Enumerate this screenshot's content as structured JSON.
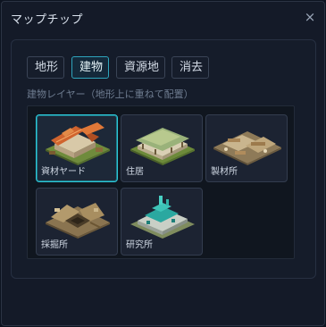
{
  "window": {
    "title": "マップチップ",
    "close_glyph": "×"
  },
  "tabs": [
    {
      "label": "地形",
      "active": false
    },
    {
      "label": "建物",
      "active": true
    },
    {
      "label": "資源地",
      "active": false
    },
    {
      "label": "消去",
      "active": false
    }
  ],
  "hint": "建物レイヤー（地形上に重ねて配置）",
  "tiles": [
    {
      "label": "資材ヤード",
      "icon": "materials-yard-icon",
      "selected": true
    },
    {
      "label": "住居",
      "icon": "house-icon",
      "selected": false
    },
    {
      "label": "製材所",
      "icon": "sawmill-icon",
      "selected": false
    },
    {
      "label": "採掘所",
      "icon": "mine-icon",
      "selected": false
    },
    {
      "label": "研究所",
      "icon": "laboratory-icon",
      "selected": false
    }
  ]
}
